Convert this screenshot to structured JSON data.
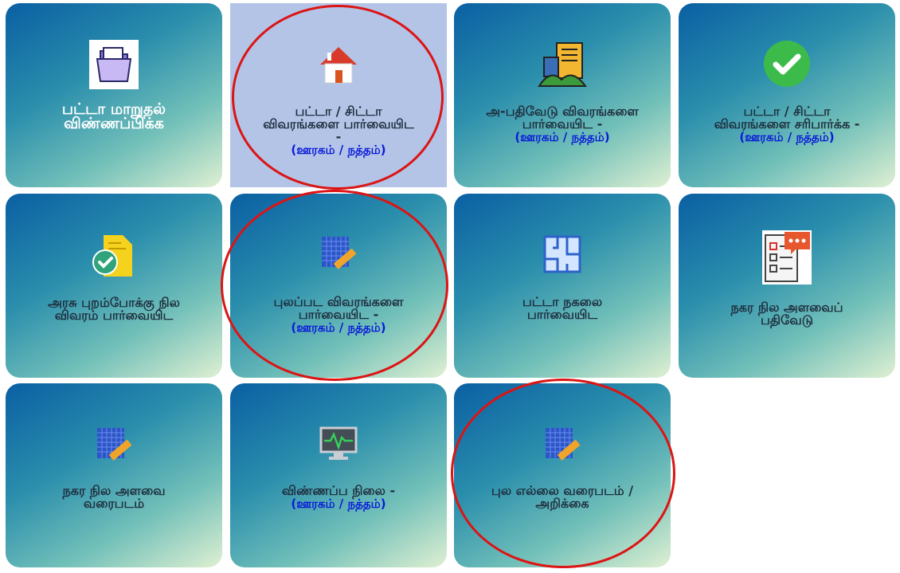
{
  "tiles": [
    {
      "line1": "பட்டா மாறுதல்",
      "line2": "விண்ணப்பிக்க",
      "line3": "",
      "sub": ""
    },
    {
      "line1": "பட்டா / சிட்டா",
      "line2": "விவரங்களை பார்வையிட",
      "line3": "-",
      "sub": "(ஊரகம் / நத்தம்)"
    },
    {
      "line1": "அ-பதிவேடு விவரங்களை",
      "line2": "பார்வையிட -",
      "line3": "",
      "sub": "(ஊரகம் / நத்தம்)"
    },
    {
      "line1": "பட்டா / சிட்டா",
      "line2": "விவரங்களை சரிபார்க்க -",
      "line3": "",
      "sub": "(ஊரகம் / நத்தம்)"
    },
    {
      "line1": "அரசு புறம்போக்கு நில",
      "line2": "விவரம் பார்வையிட",
      "line3": "",
      "sub": ""
    },
    {
      "line1": "புலப்பட விவரங்களை",
      "line2": "பார்வையிட -",
      "line3": "",
      "sub": "(ஊரகம் / நத்தம்)"
    },
    {
      "line1": "பட்டா நகலை",
      "line2": "பார்வையிட",
      "line3": "",
      "sub": ""
    },
    {
      "line1": "நகர நில அளவைப்",
      "line2": "பதிவேடு",
      "line3": "",
      "sub": ""
    },
    {
      "line1": "நகர நில அளவை",
      "line2": "வரைபடம்",
      "line3": "",
      "sub": ""
    },
    {
      "line1": "விண்ணப்ப நிலை -",
      "line2": "",
      "line3": "",
      "sub": "(ஊரகம் / நத்தம்)"
    },
    {
      "line1": "புல எல்லை வரைபடம் /",
      "line2": "அறிக்கை",
      "line3": "",
      "sub": ""
    }
  ],
  "icons": [
    "folder-icon",
    "house-icon",
    "buildings-document-icon",
    "checkmark-icon",
    "approved-document-icon",
    "survey-map-ruler-icon",
    "floor-plan-icon",
    "checklist-icon",
    "survey-map-ruler-icon",
    "monitor-icon",
    "survey-map-ruler-icon"
  ],
  "colors": {
    "accent_ring": "#dc1414",
    "sub_text": "#0a1ad8",
    "selected_bg": "#b3c4e7"
  }
}
